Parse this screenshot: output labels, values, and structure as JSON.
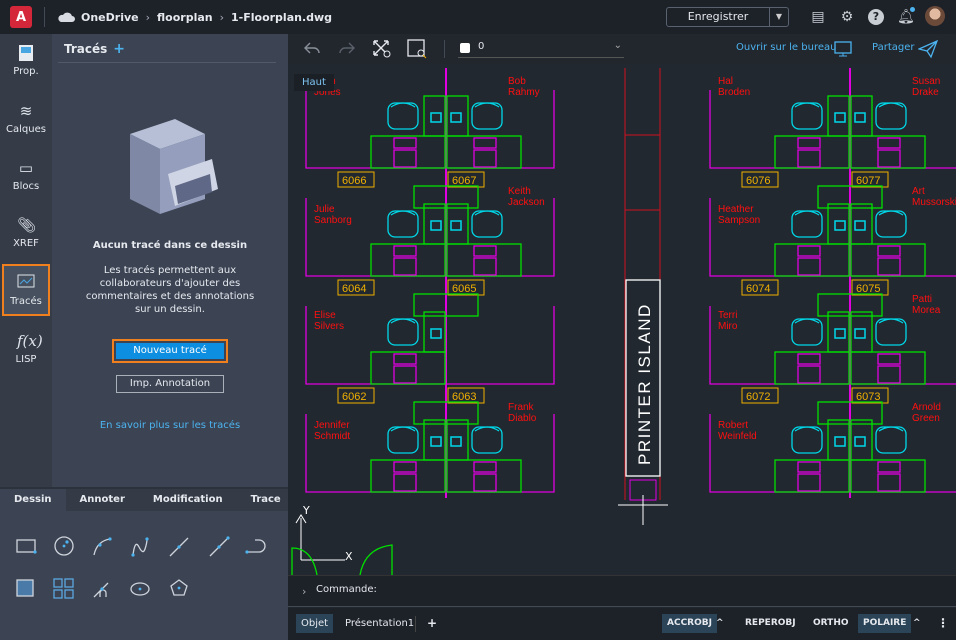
{
  "header": {
    "logo_letter": "A",
    "breadcrumb": [
      "OneDrive",
      "floorplan",
      "1-Floorplan.dwg"
    ],
    "save_label": "Enregistrer",
    "icons": [
      "print-icon",
      "settings-icon",
      "help-icon",
      "notifications-icon",
      "avatar"
    ]
  },
  "rail": {
    "items": [
      {
        "label": "Prop.",
        "icon": "properties-icon"
      },
      {
        "label": "Calques",
        "icon": "layers-icon"
      },
      {
        "label": "Blocs",
        "icon": "blocks-icon"
      },
      {
        "label": "XREF",
        "icon": "xref-icon"
      },
      {
        "label": "Tracés",
        "icon": "traces-icon",
        "active": true
      },
      {
        "label": "LISP",
        "icon": "lisp-icon"
      }
    ]
  },
  "panel": {
    "title": "Tracés",
    "empty_title": "Aucun tracé dans ce dessin",
    "empty_desc": "Les tracés permettent aux collaborateurs d'ajouter des commentaires et des annotations sur un dessin.",
    "new_button": "Nouveau tracé",
    "import_button": "Imp. Annotation",
    "learn_more": "En savoir plus sur les tracés"
  },
  "tool_tabs": {
    "tabs": [
      "Dessin",
      "Annoter",
      "Modification",
      "Trace"
    ],
    "active": "Dessin",
    "tools": [
      "rectangle",
      "circle",
      "arc",
      "spline",
      "dimension",
      "line",
      "polyline",
      "hatch",
      "array",
      "trim",
      "ellipse",
      "polygon"
    ]
  },
  "toolbar": {
    "layer_value": "0",
    "open_desktop": "Ouvrir sur le bureau",
    "share": "Partager",
    "view_label": "Haut"
  },
  "drawing": {
    "left_block": {
      "rooms": [
        [
          "6066",
          "6067"
        ],
        [
          "6064",
          "6065"
        ],
        [
          "6062",
          "6063"
        ]
      ],
      "names": [
        [
          "John Jones",
          "Bob Rahmy"
        ],
        [
          "Julie Sanborg",
          "Keith Jackson"
        ],
        [
          "Elise Silvers",
          ""
        ],
        [
          "Jennifer Schmidt",
          "Frank Diablo"
        ]
      ]
    },
    "right_block": {
      "rooms": [
        [
          "6076",
          "6077"
        ],
        [
          "6074",
          "6075"
        ],
        [
          "6072",
          "6073"
        ]
      ],
      "names": [
        [
          "Hal Broden",
          "Susan Drake"
        ],
        [
          "Heather Sampson",
          "Art Mussorski"
        ],
        [
          "Terri Miro",
          "Patti Morea"
        ],
        [
          "Robert Weinfeld",
          "Arnold Green"
        ]
      ]
    },
    "printer_island": "PRINTER ISLAND",
    "colors": {
      "wall": "#e000e0",
      "desk": "#00e000",
      "chair": "#00d8e8",
      "name": "#ff1010",
      "room": "#f0b000",
      "printer": "#ffffff"
    }
  },
  "command": {
    "label": "Commande:"
  },
  "status": {
    "tabs": [
      "Objet",
      "Présentation1"
    ],
    "toggles": [
      {
        "label": "ACCROBJ",
        "on": true
      },
      {
        "label": "REPEROBJ",
        "on": false
      },
      {
        "label": "ORTHO",
        "on": false
      },
      {
        "label": "POLAIRE",
        "on": true
      }
    ]
  }
}
